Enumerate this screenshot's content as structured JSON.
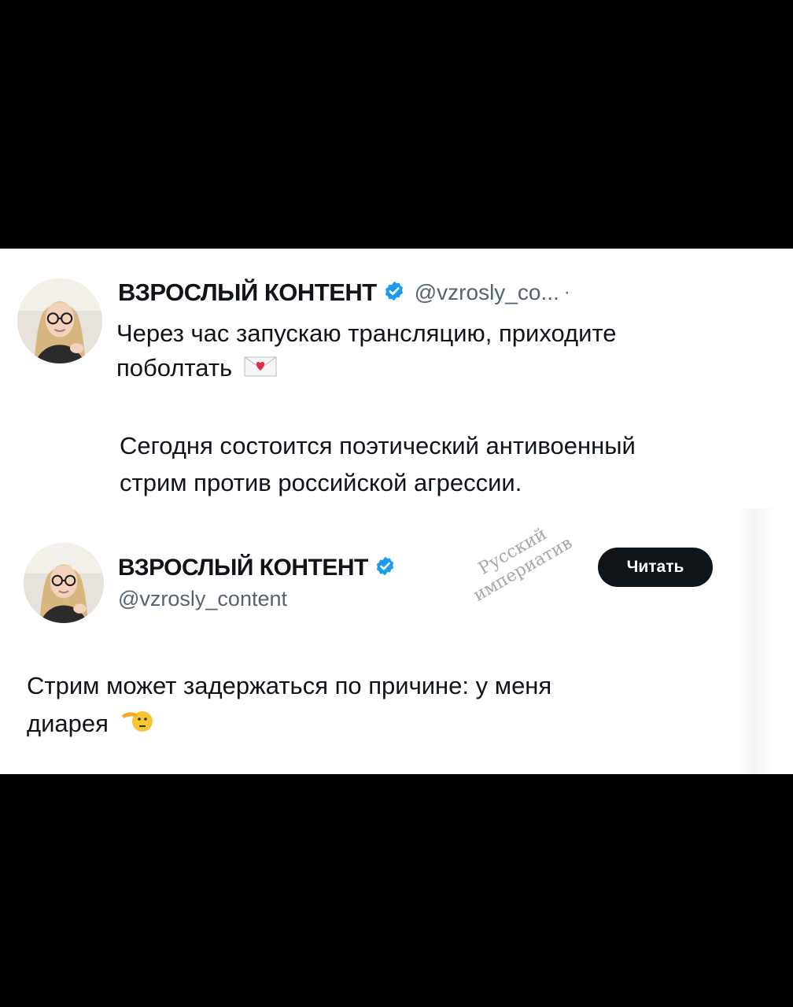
{
  "tweet1": {
    "display_name": "ВЗРОСЛЫЙ КОНТЕНТ",
    "handle": "@vzrosly_co...",
    "dot": "·",
    "text_line1": "Через час запускаю трансляцию, приходите",
    "text_line2": "поболтать",
    "emoji": "love-letter-icon"
  },
  "caption": {
    "line1": "Сегодня состоится поэтический антивоенный",
    "line2": "стрим против российской агрессии."
  },
  "tweet2": {
    "display_name": "ВЗРОСЛЫЙ КОНТЕНТ",
    "handle": "@vzrosly_content",
    "follow_button": "Читать",
    "text_line1": "Стрим может задержаться по причине: у меня",
    "text_line2": "диарея",
    "emoji": "saluting-face-icon"
  },
  "watermark": {
    "line1": "Русский",
    "line2": "империатив"
  },
  "colors": {
    "verified_blue": "#1d9bf0",
    "text": "#0f1419",
    "secondary": "#536471",
    "background": "#ffffff",
    "frame": "#000000"
  }
}
